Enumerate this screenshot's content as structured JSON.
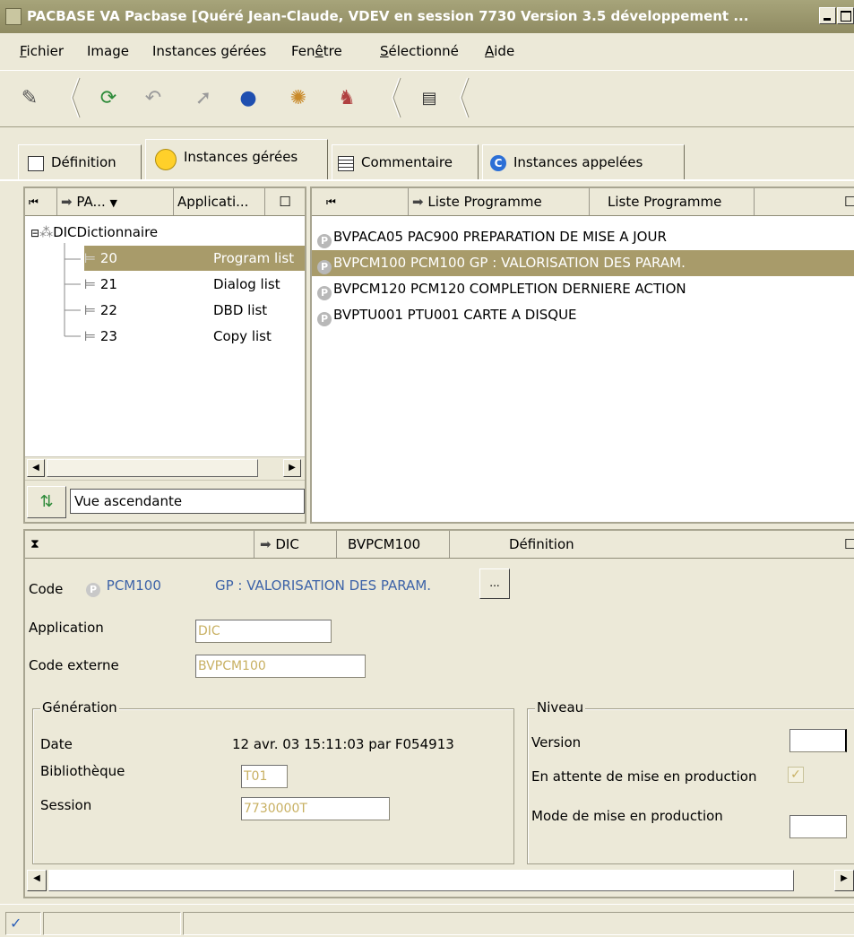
{
  "window": {
    "title": "PACBASE VA Pacbase [Quéré Jean-Claude, VDEV en session 7730 Version 3.5 développement ..."
  },
  "menu": [
    "Fichier",
    "Image",
    "Instances gérées",
    "Fenêtre",
    "Sélectionné",
    "Aide"
  ],
  "menu_access_keys": [
    "F",
    "",
    "",
    "ê",
    "S",
    "A"
  ],
  "tabs": [
    {
      "label": "Définition",
      "icon": "document-edit-icon"
    },
    {
      "label": "Instances gérées",
      "icon": "yellow-circle-icon",
      "active": true
    },
    {
      "label": "Commentaire",
      "icon": "list-icon"
    },
    {
      "label": "Instances appelées",
      "icon": "c-circle-icon"
    }
  ],
  "tree_panel": {
    "header": {
      "col1": "PA...",
      "col2": "Applicati..."
    },
    "root": "DICDictionnaire",
    "items": [
      {
        "num": "20",
        "label": "Program list",
        "selected": true
      },
      {
        "num": "21",
        "label": "Dialog list"
      },
      {
        "num": "22",
        "label": "DBD list"
      },
      {
        "num": "23",
        "label": "Copy list"
      }
    ],
    "view_label": "Vue ascendante"
  },
  "list_panel": {
    "header": {
      "col1": "Liste Programme",
      "col2": "Liste Programme"
    },
    "rows": [
      {
        "text": "BVPACA05 PAC900 PREPARATION DE MISE A JOUR"
      },
      {
        "text": "BVPCM100 PCM100 GP : VALORISATION DES PARAM.",
        "selected": true
      },
      {
        "text": "BVPCM120 PCM120 COMPLETION DERNIERE ACTION"
      },
      {
        "text": "BVPTU001 PTU001 CARTE A DISQUE"
      }
    ]
  },
  "detail": {
    "header": {
      "col1": "DIC",
      "col2": "BVPCM100",
      "col3": "Définition"
    },
    "code_label": "Code",
    "code_value": "PCM100",
    "code_desc": "GP : VALORISATION DES PARAM.",
    "browse_label": "...",
    "application_label": "Application",
    "application_value": "DIC",
    "code_externe_label": "Code externe",
    "code_externe_value": "BVPCM100",
    "generation": {
      "title": "Génération",
      "date_label": "Date",
      "date_value": "12 avr. 03 15:11:03 par F054913",
      "bibliotheque_label": "Bibliothèque",
      "bibliotheque_value": "T01",
      "session_label": "Session",
      "session_value": "7730000T"
    },
    "niveau": {
      "title": "Niveau",
      "version_label": "Version",
      "version_value": "",
      "attente_label": "En attente de mise en production",
      "attente_checked": true,
      "mode_label": "Mode de mise en production",
      "mode_value": ""
    }
  },
  "colors": {
    "title_bar": "#8f8b62",
    "selection": "#a89b6a",
    "field_text": "#c8b062",
    "link_blue": "#3d63a8"
  },
  "pcircle_letter": "P"
}
